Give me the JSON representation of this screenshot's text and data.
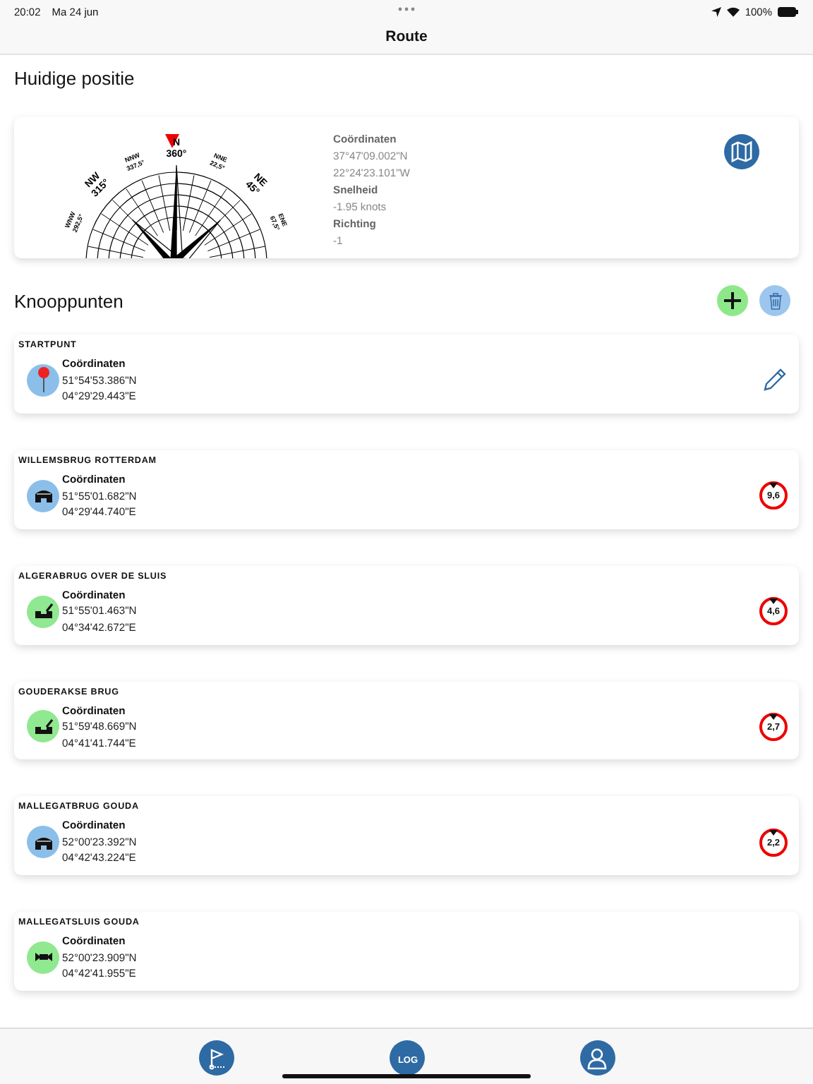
{
  "status_bar": {
    "time": "20:02",
    "date": "Ma 24 jun",
    "battery": "100%"
  },
  "nav": {
    "title": "Route"
  },
  "position": {
    "title": "Huidige positie",
    "compass": [
      {
        "point": "WNW",
        "bearing": "292,5°",
        "major": false
      },
      {
        "point": "NW",
        "bearing": "315°",
        "major": true
      },
      {
        "point": "NNW",
        "bearing": "337,5°",
        "major": false
      },
      {
        "point": "N",
        "bearing": "360°",
        "major": true
      },
      {
        "point": "NNE",
        "bearing": "22,5°",
        "major": false
      },
      {
        "point": "NE",
        "bearing": "45°",
        "major": true
      },
      {
        "point": "ENE",
        "bearing": "67,5°",
        "major": false
      }
    ],
    "fields": [
      {
        "label": "Coördinaten",
        "values": [
          "37°47'09.002\"N",
          "22°24'23.101\"W"
        ]
      },
      {
        "label": "Snelheid",
        "values": [
          "-1.95 knots"
        ]
      },
      {
        "label": "Richting",
        "values": [
          "-1"
        ]
      }
    ]
  },
  "nodes_title": "Knooppunten",
  "nodes": [
    {
      "name": "STARTPUNT",
      "kind": "start",
      "label": "Coördinaten",
      "lat": "51°54'53.386\"N",
      "lon": "04°29'29.443\"E"
    },
    {
      "name": "WILLEMSBRUG ROTTERDAM",
      "kind": "fixed_bridge",
      "label": "Coördinaten",
      "lat": "51°55'01.682\"N",
      "lon": "04°29'44.740\"E",
      "clearance": "9,6"
    },
    {
      "name": "ALGERABRUG OVER DE SLUIS",
      "kind": "lift_bridge",
      "label": "Coördinaten",
      "lat": "51°55'01.463\"N",
      "lon": "04°34'42.672\"E",
      "clearance": "4,6"
    },
    {
      "name": "GOUDERAKSE BRUG",
      "kind": "lift_bridge",
      "label": "Coördinaten",
      "lat": "51°59'48.669\"N",
      "lon": "04°41'41.744\"E",
      "clearance": "2,7"
    },
    {
      "name": "MALLEGATBRUG GOUDA",
      "kind": "fixed_bridge",
      "label": "Coördinaten",
      "lat": "52°00'23.392\"N",
      "lon": "04°42'43.224\"E",
      "clearance": "2,2"
    },
    {
      "name": "MALLEGATSLUIS GOUDA",
      "kind": "lock",
      "label": "Coördinaten",
      "lat": "52°00'23.909\"N",
      "lon": "04°42'41.955\"E"
    }
  ],
  "tab_bar": {
    "log_label": "LOG"
  }
}
